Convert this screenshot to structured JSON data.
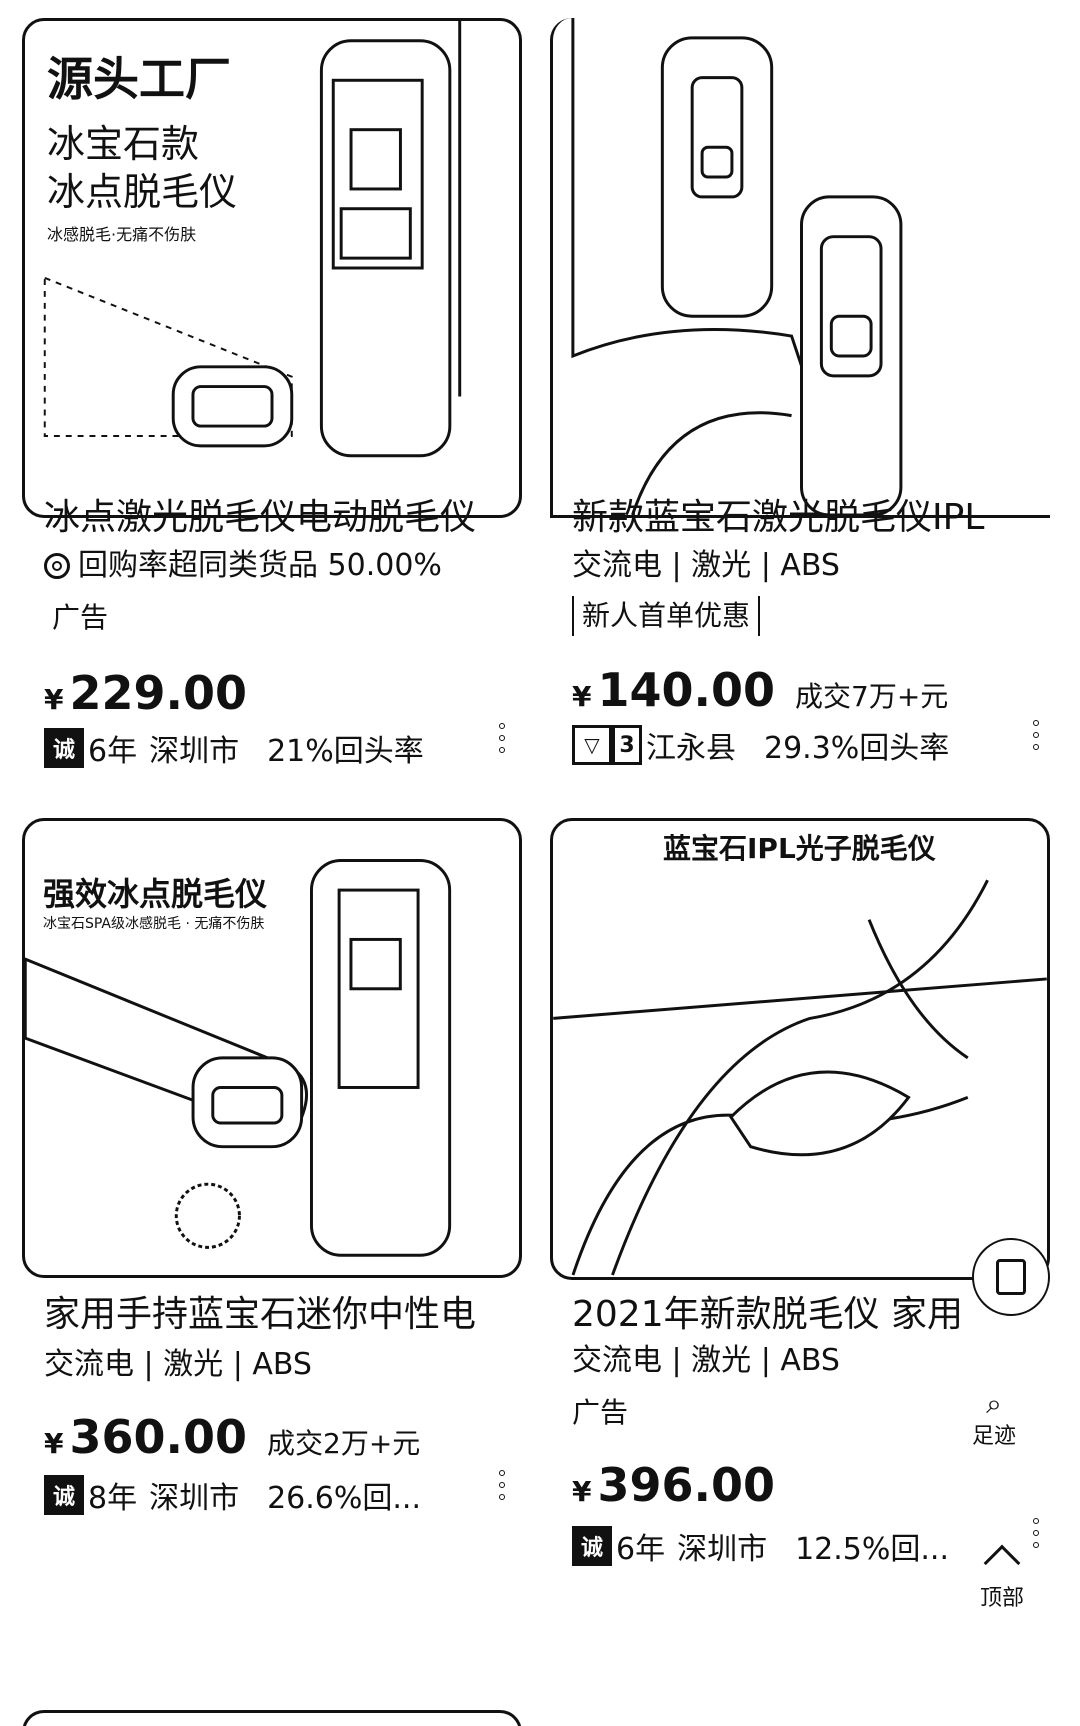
{
  "products": [
    {
      "image_text": {
        "h1": "源头工厂",
        "h2a": "冰宝石款",
        "h2b": "冰点脱毛仪",
        "sub": "冰感脱毛·无痛不伤肤"
      },
      "title": "冰点激光脱毛仪电动脱毛仪",
      "info": "回购率超同类货品 50.00%",
      "tag": "广告",
      "price_symbol": "¥",
      "price": "229.00",
      "deal": "",
      "seller_badge": "诚",
      "seller_years": "6年",
      "seller_city": "深圳市",
      "seller_repeat": "21%回头率"
    },
    {
      "image_text": {},
      "title": "新款蓝宝石激光脱毛仪IPL",
      "info": "交流电 | 激光 | ABS",
      "tag": "新人首单优惠",
      "price_symbol": "¥",
      "price": "140.00",
      "deal": "成交7万+元",
      "seller_badge": "3",
      "seller_years": "",
      "seller_city": "江永县",
      "seller_repeat": "29.3%回头率"
    },
    {
      "image_text": {
        "h1": "强效冰点脱毛仪",
        "sub": "冰宝石SPA级冰感脱毛 · 无痛不伤肤"
      },
      "title": "家用手持蓝宝石迷你中性电",
      "info": "交流电 | 激光 | ABS",
      "tag": "",
      "price_symbol": "¥",
      "price": "360.00",
      "deal": "成交2万+元",
      "seller_badge": "诚",
      "seller_years": "8年",
      "seller_city": "深圳市",
      "seller_repeat": "26.6%回..."
    },
    {
      "image_text": {
        "h1": "蓝宝石IPL光子脱毛仪"
      },
      "title": "2021年新款脱毛仪 家用",
      "info": "交流电 | 激光 | ABS",
      "tag": "广告",
      "price_symbol": "¥",
      "price": "396.00",
      "deal": "",
      "seller_badge": "诚",
      "seller_years": "6年",
      "seller_city": "深圳市",
      "seller_repeat": "12.5%回..."
    }
  ],
  "floating": {
    "footprint_label": "足迹",
    "top_label": "顶部"
  },
  "icons": {
    "repurchase": "repurchase-icon",
    "more": "more-dots-icon",
    "note": "note-icon",
    "footprint": "footprint-icon",
    "top": "chevron-up-icon"
  }
}
